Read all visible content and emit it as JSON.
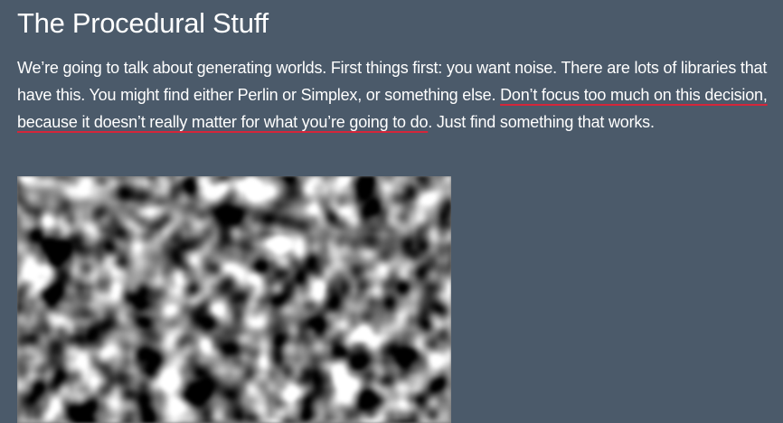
{
  "section": {
    "title": "The Procedural Stuff"
  },
  "paragraph": {
    "text_before": "We’re going to talk about generating worlds. First things first: you want noise. There are lots of libraries that have this. You might find either Perlin or Simplex, or something else. ",
    "highlighted": "Don’t focus too much on this decision, because it doesn’t really matter for what you’re going to do",
    "text_after": ". Just find something that works."
  },
  "figure": {
    "description_icon": "noise-texture-image",
    "colors": {
      "background": "#4b5a6a",
      "underline": "#d5263a"
    }
  }
}
